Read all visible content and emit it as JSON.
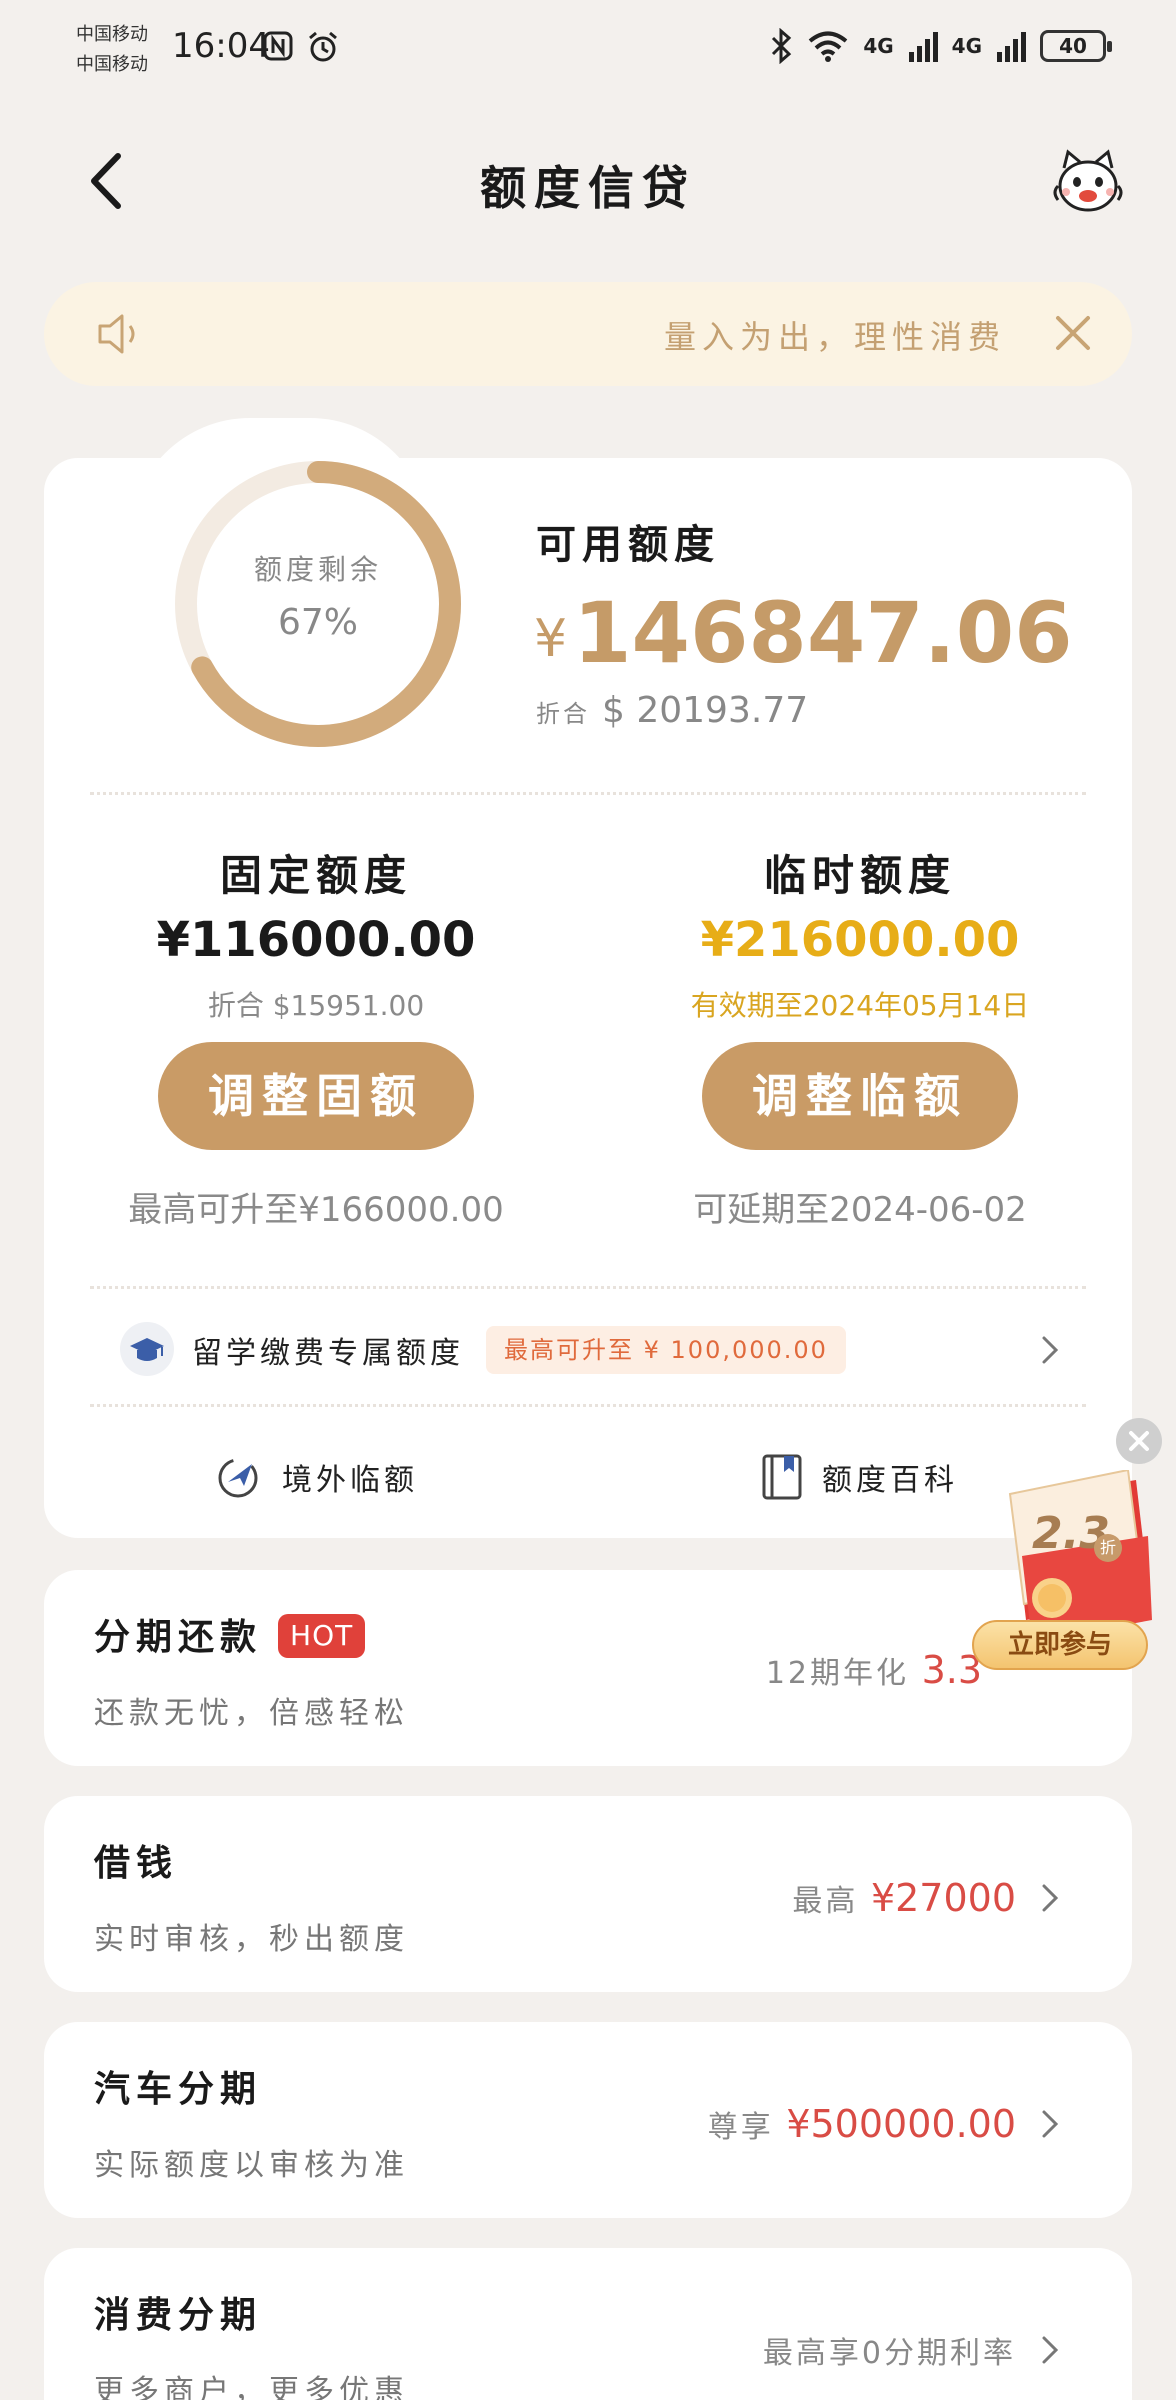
{
  "status_bar": {
    "carrier_1": "中国移动",
    "carrier_2": "中国移动",
    "time": "16:04",
    "net_1": "4G",
    "net_2": "4G",
    "battery": "40"
  },
  "header": {
    "title": "额度信贷"
  },
  "notice": {
    "text": "量入为出，理性消费"
  },
  "credit": {
    "ring_label": "额度剩余",
    "ring_percent_text": "67%",
    "ring_fraction": 0.67,
    "available_label": "可用额度",
    "currency_symbol": "¥",
    "available_amount": "146847.06",
    "usd_prefix": "折合",
    "usd_amount": "$ 20193.77"
  },
  "fixed": {
    "title": "固定额度",
    "amount": "¥116000.00",
    "sub": "折合 $15951.00",
    "button": "调整固额",
    "note": "最高可升至¥166000.00"
  },
  "temporary": {
    "title": "临时额度",
    "amount": "¥216000.00",
    "sub": "有效期至2024年05月14日",
    "button": "调整临额",
    "note": "可延期至2024-06-02"
  },
  "study_abroad": {
    "label": "留学缴费专属额度",
    "badge": "最高可升至 ¥ 100,000.00"
  },
  "links": {
    "overseas": "境外临额",
    "wiki": "额度百科"
  },
  "promo": {
    "discount": "2.3",
    "unit": "折",
    "join": "立即参与"
  },
  "products": [
    {
      "title": "分期还款",
      "badge": "HOT",
      "subtitle": "还款无忧，倍感轻松",
      "right_prefix": "12期年化",
      "right_value": "3.3"
    },
    {
      "title": "借钱",
      "subtitle": "实时审核，秒出额度",
      "right_prefix": "最高",
      "right_value": "¥27000"
    },
    {
      "title": "汽车分期",
      "subtitle": "实际额度以审核为准",
      "right_prefix": "尊享",
      "right_value": "¥500000.00"
    },
    {
      "title": "消费分期",
      "subtitle": "更多商户，更多优惠",
      "right_prefix": "最高享0分期利率",
      "right_value": ""
    }
  ],
  "colors": {
    "accent_gold": "#c59b68",
    "button_gold": "#c99b66",
    "temp_yellow": "#e7ad17",
    "price_red": "#d94c45",
    "background": "#f3f0ed"
  }
}
